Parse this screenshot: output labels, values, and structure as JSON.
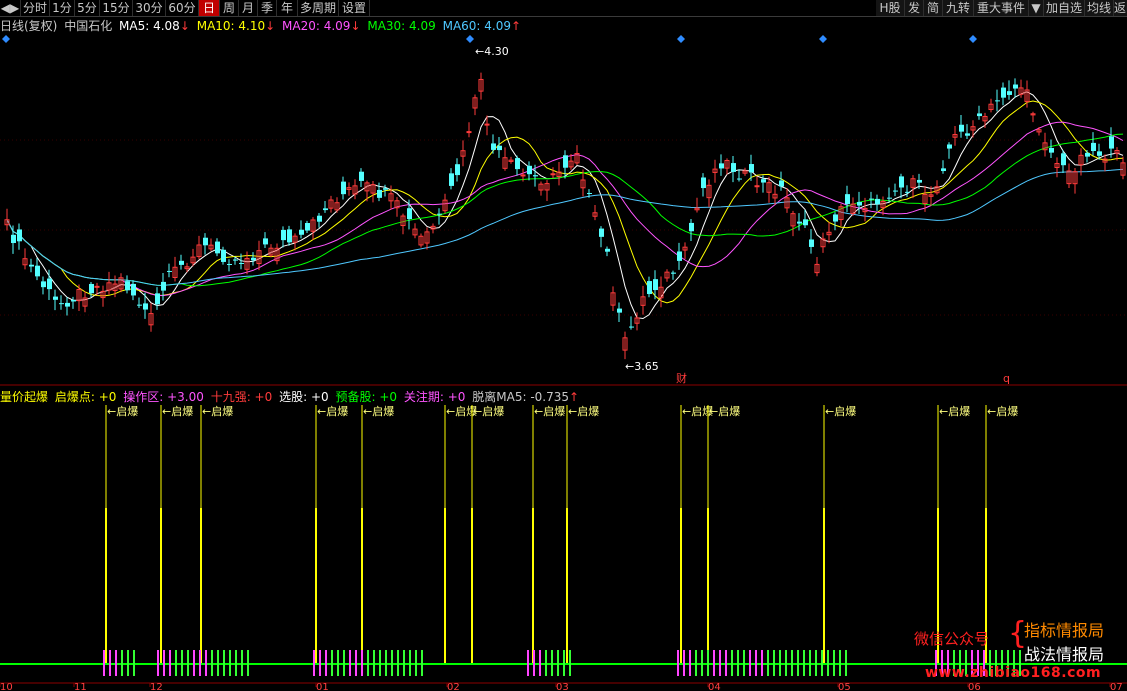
{
  "toolbar": {
    "left": [
      "◀▶",
      "分时",
      "1分",
      "5分",
      "15分",
      "30分",
      "60分",
      "日",
      "周",
      "月",
      "季",
      "年",
      "多周期",
      "设置"
    ],
    "right": [
      "H股",
      "发",
      "简",
      "九转",
      "重大事件",
      "▼",
      "加自选",
      "均线",
      "返回"
    ]
  },
  "price_header": {
    "period": "日线(复权)",
    "stock": "中国石化",
    "ma5": "MA5: 4.08",
    "ma5_arrow": "↓",
    "ma10": "MA10: 4.10",
    "ma10_arrow": "↓",
    "ma20": "MA20: 4.09",
    "ma20_arrow": "↓",
    "ma30": "MA30: 4.09",
    "ma60": "MA60: 4.09",
    "ma60_arrow": "↑"
  },
  "price_annotations": {
    "high": "4.30",
    "low": "3.65",
    "event_cai": "财",
    "event_q": "q"
  },
  "indicator_header": {
    "name": "量价起爆",
    "qibao": "启爆点: +0",
    "caozuo": "操作区: +3.00",
    "shijiu": "十九强: +0",
    "xuangu": "选股: +0",
    "yubei": "预备股: +0",
    "guanzhu": "关注期: +0",
    "tuoli": "脱离MA5: -0.735",
    "tuoli_arrow": "↑"
  },
  "signal_label": "启爆",
  "x_axis": [
    "10",
    "11",
    "12",
    "01",
    "02",
    "03",
    "04",
    "05",
    "06",
    "07"
  ],
  "watermark": {
    "wechat": "微信公众号",
    "brace": "{",
    "line1": "指标情报局",
    "line2": "战法情报局",
    "site": "www.zhibiao168.com"
  },
  "colors": {
    "up": "#ff3b3b",
    "down": "#54ffff",
    "ma5": "#ffffff",
    "ma10": "#ffff00",
    "ma20": "#ff55ff",
    "ma30": "#00ff00",
    "ma60": "#4fc8ff",
    "signal": "#ffff00",
    "baseline": "#00ff00"
  }
}
